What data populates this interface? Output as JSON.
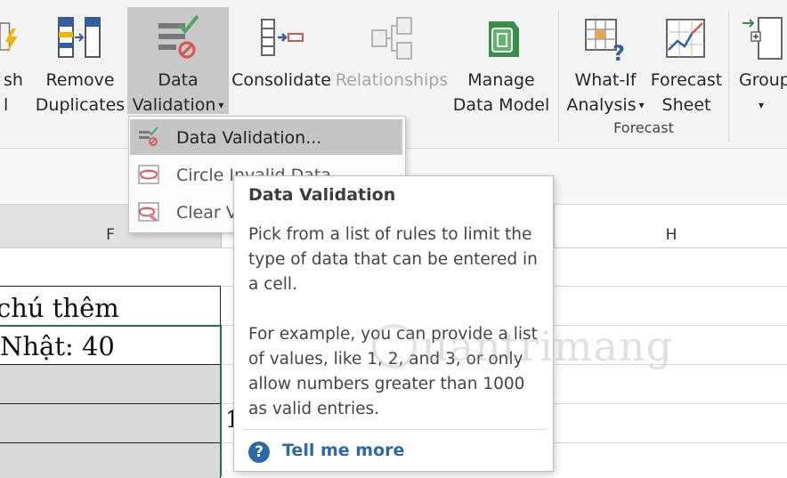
{
  "ribbon": {
    "partial_refresh": {
      "line1": "sh",
      "line2": "l"
    },
    "remove_duplicates": {
      "line1": "Remove",
      "line2": "Duplicates"
    },
    "data_validation": {
      "line1": "Data",
      "line2": "Validation"
    },
    "consolidate": {
      "label": "Consolidate"
    },
    "relationships": {
      "label": "Relationships"
    },
    "manage_data_model": {
      "line1": "Manage",
      "line2": "Data Model"
    },
    "what_if": {
      "line1": "What-If",
      "line2": "Analysis"
    },
    "forecast_sheet": {
      "line1": "Forecast",
      "line2": "Sheet"
    },
    "group": {
      "label": "Group"
    },
    "forecast_group_label": "Forecast",
    "dropdown_caret": "▾"
  },
  "menu": {
    "items": [
      {
        "label": "Data Validation...",
        "highlighted": true
      },
      {
        "label": "Circle Invalid Data"
      },
      {
        "label": "Clear Validation Circles"
      }
    ]
  },
  "columns": {
    "f": "F",
    "h": "H"
  },
  "cells": {
    "f1": "chú thêm",
    "f2": " Nhật: 40",
    "g4": "1"
  },
  "tooltip": {
    "title": "Data Validation",
    "para1": "Pick from a list of rules to limit the type of data that can be entered in a cell.",
    "para2": "For example, you can provide a list of values, like 1, 2, and 3, or only allow numbers greater than 1000 as valid entries.",
    "help_label": "Tell me more"
  },
  "watermark": "uantrimang",
  "colors": {
    "accent_blue": "#2b6aa8",
    "active_button_bg": "#c8c8c8",
    "selection_green": "#217346"
  }
}
